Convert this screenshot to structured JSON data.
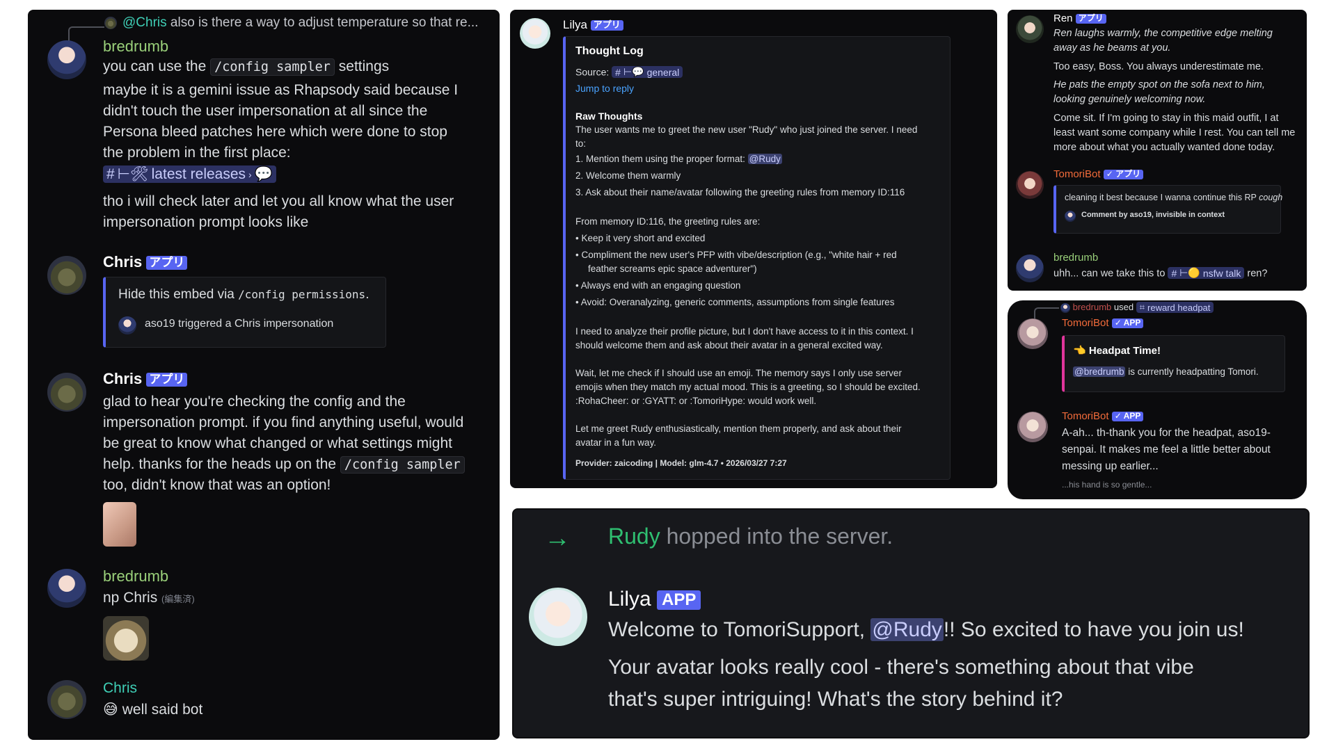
{
  "left": {
    "reply_user": "@Chris",
    "reply_text": "also is there a way to adjust temperature so that re...",
    "msg1": {
      "author": "bredrumb",
      "l1_pre": "you can use the",
      "l1_code": "/config sampler",
      "l1_post": "settings",
      "p2": [
        "maybe it is a gemini issue as Rhapsody said because I",
        "didn't touch the user impersonation at all since the",
        "Persona bleed patches here which were done to stop",
        "the problem in the first place:"
      ],
      "channel": "latest releases",
      "p3": [
        "tho i will check later and let you all know what the user",
        "impersonation prompt looks like"
      ]
    },
    "msg2": {
      "author": "Chris",
      "badge": "アプリ",
      "embed_pre": "Hide this embed via",
      "embed_code": "/config permissions",
      "embed_post": ".",
      "embed_footer": "aso19 triggered a Chris impersonation"
    },
    "msg3": {
      "author": "Chris",
      "badge": "アプリ",
      "lines": [
        "glad to hear you're checking the config and the",
        "impersonation prompt. if you find anything useful, would",
        "be great to know what changed or what settings might"
      ],
      "l4_pre": "help. thanks for the heads up on the",
      "l4_code": "/config sampler",
      "l5": "too, didn't know that was an option!"
    },
    "msg4": {
      "author": "bredrumb",
      "text": "np Chris",
      "edited": "(編集済)"
    },
    "msg5": {
      "author": "Chris",
      "text": "well said bot",
      "emoji": "😅"
    }
  },
  "middle": {
    "author": "Lilya",
    "badge": "アプリ",
    "title": "Thought Log",
    "source_label": "Source:",
    "source_channel": "general",
    "jump": "Jump to reply",
    "raw_title": "Raw Thoughts",
    "p1": [
      "The user wants me to greet the new user \"Rudy\" who just joined the server. I need",
      "to:"
    ],
    "list1_1_pre": "1. Mention them using the proper format:",
    "list1_1_mention": "@Rudy",
    "list1": [
      "2. Welcome them warmly",
      "3. Ask about their name/avatar following the greeting rules from memory ID:116"
    ],
    "p2": "From memory ID:116, the greeting rules are:",
    "bullets": [
      "Keep it very short and excited",
      "Compliment the new user's PFP with vibe/description (e.g., \"white hair + red",
      "feather screams epic space adventurer\")",
      "Always end with an engaging question",
      "Avoid: Overanalyzing, generic comments, assumptions from single features"
    ],
    "p3": [
      "I need to analyze their profile picture, but I don't have access to it in this context. I",
      "should welcome them and ask about their avatar in a general excited way."
    ],
    "p4": [
      "Wait, let me check if I should use an emoji. The memory says I only use server",
      "emojis when they match my actual mood. This is a greeting, so I should be excited.",
      ":RohaCheer: or :GYATT: or :TomoriHype: would work well."
    ],
    "p5": [
      "Let me greet Rudy enthusiastically, mention them properly, and ask about their",
      "avatar in a fun way."
    ],
    "footer": "Provider: zaicoding | Model: glm-4.7 • 2026/03/27 7:27"
  },
  "top_right": {
    "ren": {
      "author": "Ren",
      "badge": "アプリ",
      "lines": [
        "Ren laughs warmly, the competitive edge melting",
        "away as he beams at you.",
        "Too easy, Boss. You always underestimate me.",
        "He pats the empty spot on the sofa next to him,",
        "looking genuinely welcoming now.",
        "Come sit. If I'm going to stay in this maid outfit, I at",
        "least want some company while I rest. You can tell me",
        "more about what you actually wanted done today."
      ]
    },
    "tomori": {
      "author": "TomoriBot",
      "badge": "✓ アプリ",
      "embed_pre": "cleaning it best because I wanna continue this RP",
      "embed_italic": "cough",
      "embed_footer": "Comment by aso19, invisible in context"
    },
    "bred": {
      "author": "bredrumb",
      "pre": "uhh... can we take this to",
      "channel": "nsfw talk",
      "post": "ren?"
    }
  },
  "mid_right": {
    "reply_user": "bredrumb",
    "reply_used": "used",
    "reply_cmd": "reward headpat",
    "m1": {
      "author": "TomoriBot",
      "badge": "✓ APP",
      "embed_title": "Headpat Time!",
      "mention": "@bredrumb",
      "embed_text": "is currently headpatting Tomori."
    },
    "m2": {
      "author": "TomoriBot",
      "badge": "✓ APP",
      "lines": [
        "A-ah... th-thank you for the headpat, aso19-",
        "senpai. It makes me feel a little better about",
        "messing up earlier..."
      ],
      "small": "...his hand is so gentle..."
    }
  },
  "bottom": {
    "join_user": "Rudy",
    "join_text": "hopped into the server.",
    "author": "Lilya",
    "badge": "APP",
    "l1_pre": "Welcome to TomoriSupport,",
    "l1_mention": "@Rudy",
    "l1_post": "!! So excited to have you join us!",
    "l2": "Your avatar looks really cool - there's something about that vibe",
    "l3": "that's super intriguing! What's the story behind it?"
  },
  "colors": {
    "accent": "#5865f2",
    "bred": "#9ad07a",
    "chris": "#3fcfb6",
    "tomori": "#f26b3a",
    "join_green": "#2fbf71"
  }
}
